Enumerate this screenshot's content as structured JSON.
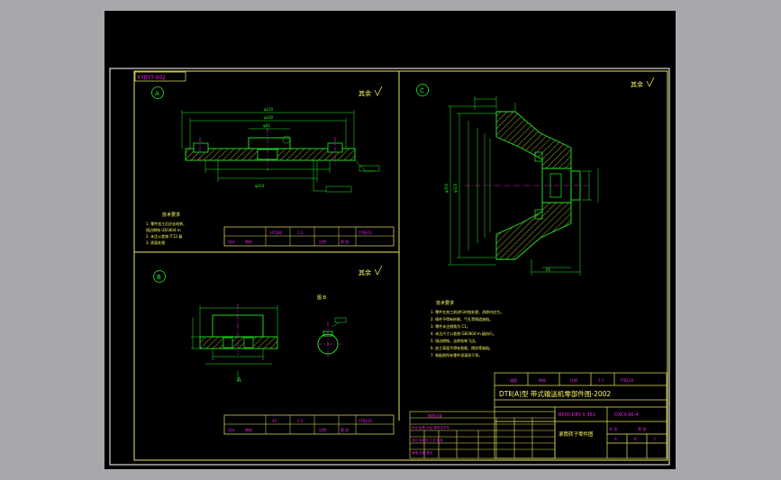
{
  "colors": {
    "frame": "#ffffff",
    "border": "#e8e85a",
    "outline": "#22ee22",
    "dim": "#22ee22",
    "center": "#dd22dd",
    "hatch": "#cfcf3a",
    "text_cn": "#ffff66",
    "text_mag": "#ee22ee",
    "background": "#000000",
    "app_bg": "#a7a8ab"
  },
  "sheet": {
    "stamp": "XYBYT-002",
    "view_a_label": "A",
    "view_b_label": "B",
    "view_c_label": "C",
    "section_b_label": "A",
    "aux_view_label": "图 B",
    "roughness_a": "其余",
    "roughness_b": "其余",
    "roughness_c": "其余"
  },
  "notes_a": {
    "title": "技术要求",
    "lines": [
      "1. 零件加工后应去毛刺、",
      "   锐边倒钝 GB1804-m",
      "2. 未注公差按 IT12 级",
      "3. 表面处理"
    ]
  },
  "notes_c": {
    "title": "技术要求",
    "lines": [
      "1. 零件在加工前进行时效处理，消除内应力。",
      "2. 铸件不得有砂眼、气孔等铸造缺陷。",
      "3. 零件未注倒角为 C1。",
      "4. 未注尺寸公差按 GB1804-m 级执行。",
      "5. 锐边倒钝，去除毛刺飞边。",
      "6. 加工表面不得有划痕、擦伤等缺陷。",
      "7. 装配前所有零件须清洗干净。"
    ]
  },
  "title_strip_a": [
    "设计",
    "审核",
    "HT200",
    "1:1",
    "比例",
    "第 张",
    "YTBJ-01"
  ],
  "title_strip_b": [
    "设计",
    "审核",
    "45",
    "1:1",
    "比例",
    "第 张",
    "YTBJ-02"
  ],
  "main_title": {
    "header_cells": [
      "描图",
      "审核",
      "比例",
      "1:1",
      "YTBJ-03"
    ],
    "title": "DTⅡ(A)型  带式输送机零部件图-2002",
    "spec": "B500 D80 X 351",
    "code": "DXCS-06-4",
    "part_name": "滚筒转子零件图",
    "small_cells": [
      "标记",
      "处数",
      "分区",
      "签名",
      "年月日"
    ],
    "right_cells": [
      "共 张",
      "第 张",
      "A",
      "B",
      "C"
    ]
  },
  "rev_table_header": "修改记录",
  "rev_table_rows": [
    "标记 处数 分区 更改文件号",
    "设计 标准化 工艺 批准",
    "审核 日期 签名"
  ]
}
